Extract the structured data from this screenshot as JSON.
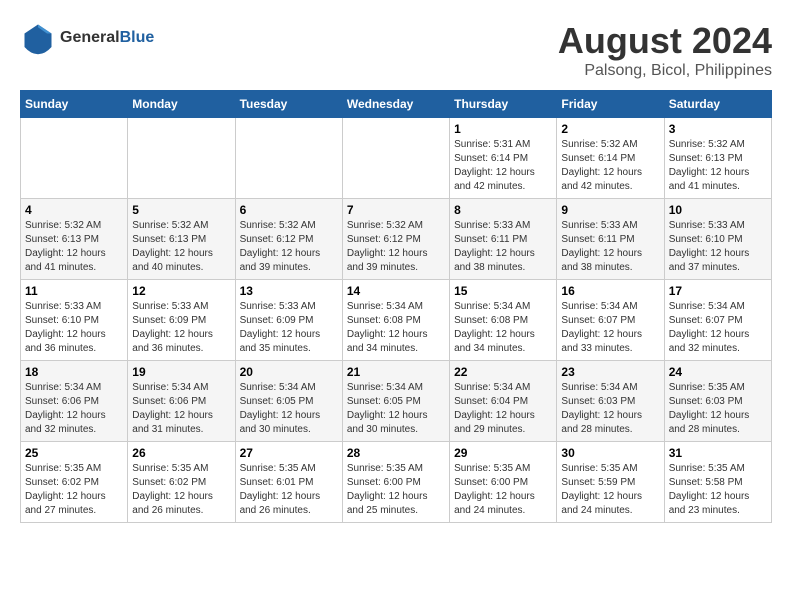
{
  "header": {
    "logo_line1": "General",
    "logo_line2": "Blue",
    "month_year": "August 2024",
    "location": "Palsong, Bicol, Philippines"
  },
  "weekdays": [
    "Sunday",
    "Monday",
    "Tuesday",
    "Wednesday",
    "Thursday",
    "Friday",
    "Saturday"
  ],
  "weeks": [
    [
      {
        "day": "",
        "info": ""
      },
      {
        "day": "",
        "info": ""
      },
      {
        "day": "",
        "info": ""
      },
      {
        "day": "",
        "info": ""
      },
      {
        "day": "1",
        "info": "Sunrise: 5:31 AM\nSunset: 6:14 PM\nDaylight: 12 hours\nand 42 minutes."
      },
      {
        "day": "2",
        "info": "Sunrise: 5:32 AM\nSunset: 6:14 PM\nDaylight: 12 hours\nand 42 minutes."
      },
      {
        "day": "3",
        "info": "Sunrise: 5:32 AM\nSunset: 6:13 PM\nDaylight: 12 hours\nand 41 minutes."
      }
    ],
    [
      {
        "day": "4",
        "info": "Sunrise: 5:32 AM\nSunset: 6:13 PM\nDaylight: 12 hours\nand 41 minutes."
      },
      {
        "day": "5",
        "info": "Sunrise: 5:32 AM\nSunset: 6:13 PM\nDaylight: 12 hours\nand 40 minutes."
      },
      {
        "day": "6",
        "info": "Sunrise: 5:32 AM\nSunset: 6:12 PM\nDaylight: 12 hours\nand 39 minutes."
      },
      {
        "day": "7",
        "info": "Sunrise: 5:32 AM\nSunset: 6:12 PM\nDaylight: 12 hours\nand 39 minutes."
      },
      {
        "day": "8",
        "info": "Sunrise: 5:33 AM\nSunset: 6:11 PM\nDaylight: 12 hours\nand 38 minutes."
      },
      {
        "day": "9",
        "info": "Sunrise: 5:33 AM\nSunset: 6:11 PM\nDaylight: 12 hours\nand 38 minutes."
      },
      {
        "day": "10",
        "info": "Sunrise: 5:33 AM\nSunset: 6:10 PM\nDaylight: 12 hours\nand 37 minutes."
      }
    ],
    [
      {
        "day": "11",
        "info": "Sunrise: 5:33 AM\nSunset: 6:10 PM\nDaylight: 12 hours\nand 36 minutes."
      },
      {
        "day": "12",
        "info": "Sunrise: 5:33 AM\nSunset: 6:09 PM\nDaylight: 12 hours\nand 36 minutes."
      },
      {
        "day": "13",
        "info": "Sunrise: 5:33 AM\nSunset: 6:09 PM\nDaylight: 12 hours\nand 35 minutes."
      },
      {
        "day": "14",
        "info": "Sunrise: 5:34 AM\nSunset: 6:08 PM\nDaylight: 12 hours\nand 34 minutes."
      },
      {
        "day": "15",
        "info": "Sunrise: 5:34 AM\nSunset: 6:08 PM\nDaylight: 12 hours\nand 34 minutes."
      },
      {
        "day": "16",
        "info": "Sunrise: 5:34 AM\nSunset: 6:07 PM\nDaylight: 12 hours\nand 33 minutes."
      },
      {
        "day": "17",
        "info": "Sunrise: 5:34 AM\nSunset: 6:07 PM\nDaylight: 12 hours\nand 32 minutes."
      }
    ],
    [
      {
        "day": "18",
        "info": "Sunrise: 5:34 AM\nSunset: 6:06 PM\nDaylight: 12 hours\nand 32 minutes."
      },
      {
        "day": "19",
        "info": "Sunrise: 5:34 AM\nSunset: 6:06 PM\nDaylight: 12 hours\nand 31 minutes."
      },
      {
        "day": "20",
        "info": "Sunrise: 5:34 AM\nSunset: 6:05 PM\nDaylight: 12 hours\nand 30 minutes."
      },
      {
        "day": "21",
        "info": "Sunrise: 5:34 AM\nSunset: 6:05 PM\nDaylight: 12 hours\nand 30 minutes."
      },
      {
        "day": "22",
        "info": "Sunrise: 5:34 AM\nSunset: 6:04 PM\nDaylight: 12 hours\nand 29 minutes."
      },
      {
        "day": "23",
        "info": "Sunrise: 5:34 AM\nSunset: 6:03 PM\nDaylight: 12 hours\nand 28 minutes."
      },
      {
        "day": "24",
        "info": "Sunrise: 5:35 AM\nSunset: 6:03 PM\nDaylight: 12 hours\nand 28 minutes."
      }
    ],
    [
      {
        "day": "25",
        "info": "Sunrise: 5:35 AM\nSunset: 6:02 PM\nDaylight: 12 hours\nand 27 minutes."
      },
      {
        "day": "26",
        "info": "Sunrise: 5:35 AM\nSunset: 6:02 PM\nDaylight: 12 hours\nand 26 minutes."
      },
      {
        "day": "27",
        "info": "Sunrise: 5:35 AM\nSunset: 6:01 PM\nDaylight: 12 hours\nand 26 minutes."
      },
      {
        "day": "28",
        "info": "Sunrise: 5:35 AM\nSunset: 6:00 PM\nDaylight: 12 hours\nand 25 minutes."
      },
      {
        "day": "29",
        "info": "Sunrise: 5:35 AM\nSunset: 6:00 PM\nDaylight: 12 hours\nand 24 minutes."
      },
      {
        "day": "30",
        "info": "Sunrise: 5:35 AM\nSunset: 5:59 PM\nDaylight: 12 hours\nand 24 minutes."
      },
      {
        "day": "31",
        "info": "Sunrise: 5:35 AM\nSunset: 5:58 PM\nDaylight: 12 hours\nand 23 minutes."
      }
    ]
  ]
}
